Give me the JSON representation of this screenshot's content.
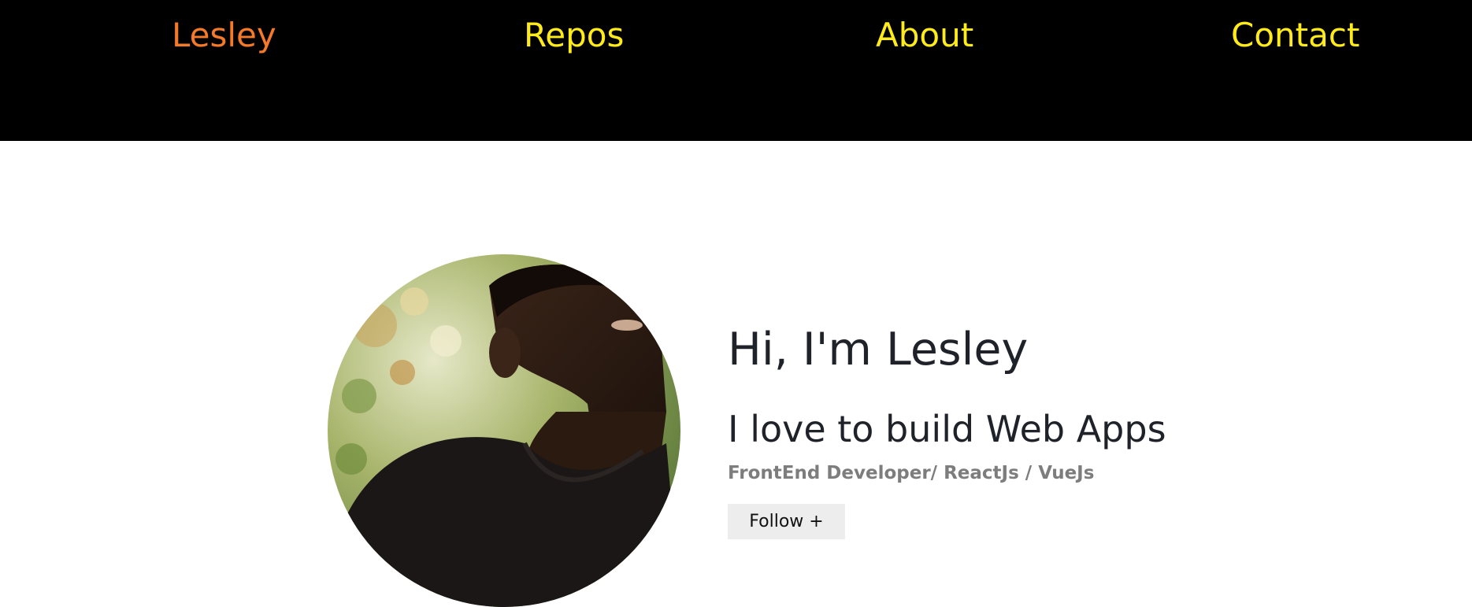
{
  "nav": {
    "brand": "Lesley",
    "items": [
      {
        "label": "Repos"
      },
      {
        "label": "About"
      },
      {
        "label": "Contact"
      }
    ]
  },
  "profile": {
    "avatar_icon": "profile-photo",
    "greeting": "Hi, I'm Lesley",
    "tagline": "I love to build Web Apps",
    "role": "FrontEnd Developer/ ReactJs / VueJs",
    "follow_label": "Follow +"
  },
  "colors": {
    "nav_background": "#000000",
    "brand": "#f47a2a",
    "nav_link": "#ffeb1a",
    "heading": "#1f2329",
    "role_text": "#7d7d7d",
    "button_background": "#ededed"
  }
}
